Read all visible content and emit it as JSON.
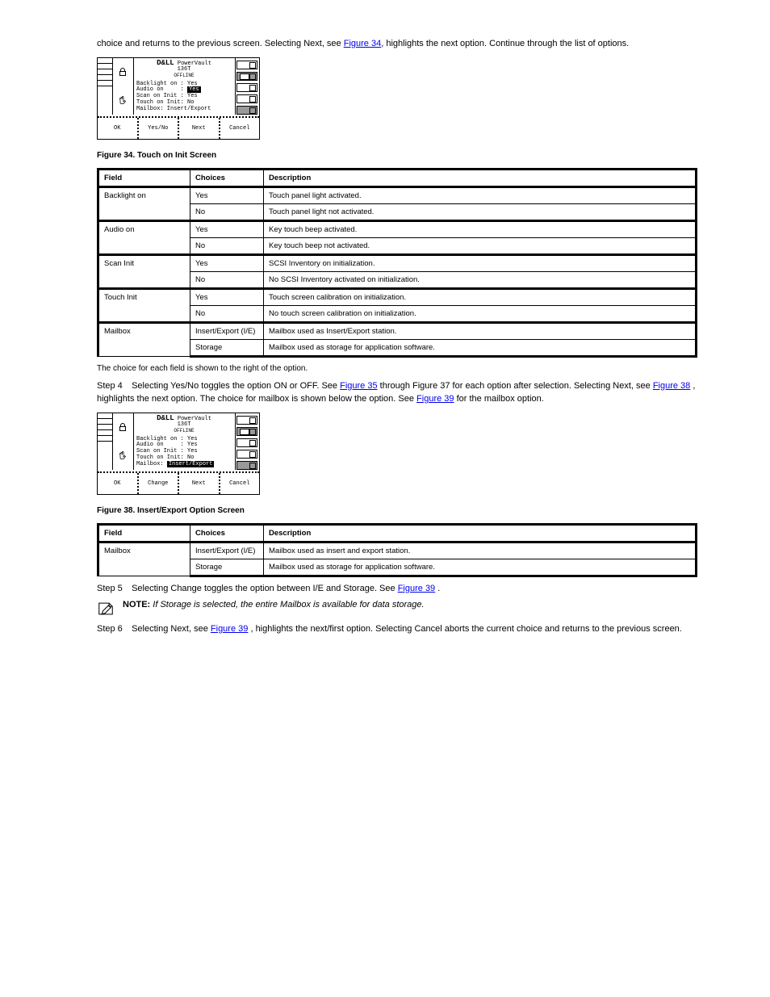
{
  "intro_line": "choice and returns to the previous screen. Selecting Next, see",
  "intro_link": "Figure 34",
  "intro_tail": ", highlights the next option. Continue through the list of options.",
  "fig34_caption": "Figure 34. Touch on Init Screen",
  "fig38_caption": "Figure 38. Insert/Export Option Screen",
  "device": {
    "brand_big": "D&LL",
    "brand_mid": "PowerVault",
    "brand_model": "136T",
    "brand_off": "OFFLINE",
    "fig34_lines": [
      {
        "label": "Backlight on :",
        "val": "Yes",
        "hi": false
      },
      {
        "label": "Audio on     :",
        "val": "Yes",
        "hi": true
      },
      {
        "label": "Scan on Init :",
        "val": "Yes",
        "hi": false
      },
      {
        "label": "Touch on Init:",
        "val": "No",
        "hi": false
      },
      {
        "label": "Mailbox: Insert/Export",
        "val": "",
        "hi": false
      }
    ],
    "fig38_lines": [
      {
        "label": "Backlight on :",
        "val": "Yes",
        "hi": false
      },
      {
        "label": "Audio on     :",
        "val": "Yes",
        "hi": false
      },
      {
        "label": "Scan on Init :",
        "val": "Yes",
        "hi": false
      },
      {
        "label": "Touch on Init:",
        "val": "No",
        "hi": false
      },
      {
        "label": "Mailbox: ",
        "val": "Insert/Export",
        "hi": true
      }
    ],
    "btn_ok": "OK",
    "btn_yesno": "Yes/No",
    "btn_change": "Change",
    "btn_next": "Next",
    "btn_cancel": "Cancel"
  },
  "table34": {
    "head_field": "Field",
    "head_choice": "Choices",
    "head_desc": "Description",
    "rows": [
      {
        "field": "Backlight on",
        "c": "Yes",
        "d": "Touch panel light activated.",
        "group": true
      },
      {
        "field": "",
        "c": "No",
        "d": "Touch panel light not activated."
      },
      {
        "field": "Audio on",
        "c": "Yes",
        "d": "Key touch beep activated.",
        "group": true
      },
      {
        "field": "",
        "c": "No",
        "d": "Key touch beep not activated."
      },
      {
        "field": "Scan Init",
        "c": "Yes",
        "d": "SCSI Inventory on initialization.",
        "group": true
      },
      {
        "field": "",
        "c": "No",
        "d": "No SCSI Inventory activated on initialization."
      },
      {
        "field": "Touch Init",
        "c": "Yes",
        "d": "Touch screen calibration on initialization.",
        "group": true
      },
      {
        "field": "",
        "c": "No",
        "d": "No touch screen calibration on initialization."
      },
      {
        "field": "Mailbox",
        "c": "Insert/Export (I/E)",
        "d": "Mailbox used as Insert/Export station.",
        "group": true
      },
      {
        "field": "",
        "c": "Storage",
        "d": "Mailbox used as storage for application software.",
        "last": true
      }
    ]
  },
  "t34_sentence": "The choice for each field is shown to the right of the option.",
  "step4_lead": "Step 4",
  "step4_body_a": "Selecting Yes/No toggles the option ON or OFF. See",
  "step4_link": "Figure 35",
  "step4_body_b": " through Figure 37 for each option after selection. Selecting Next, see",
  "step4_link2": "Figure 38",
  "step4_body_c": ", highlights the next option. The choice for mailbox is shown below the option. See",
  "step4_link3": "Figure 39",
  "step4_body_d": " for the mailbox option.",
  "table38": {
    "head_field": "Field",
    "head_choice": "Choices",
    "head_desc": "Description",
    "rows": [
      {
        "field": "Mailbox",
        "c": "Insert/Export (I/E)",
        "d": "Mailbox used as insert and export station.",
        "group": true
      },
      {
        "field": "",
        "c": "Storage",
        "d": "Mailbox used as storage for application software.",
        "last": true
      }
    ]
  },
  "step5_lead": "Step 5",
  "step5_body_a": "Selecting Change toggles the option between I/E and Storage. See",
  "step5_link": "Figure 39",
  "step5_body_b": ".",
  "note_bold": "NOTE:",
  "note_ital": "If Storage is selected, the entire Mailbox is available for data storage.",
  "step6_lead": "Step 6",
  "step6_body_a": "Selecting Next, see",
  "step6_link": "Figure 39",
  "step6_body_b": ", highlights the next/first option. Selecting Cancel aborts the current choice and returns to the previous screen."
}
